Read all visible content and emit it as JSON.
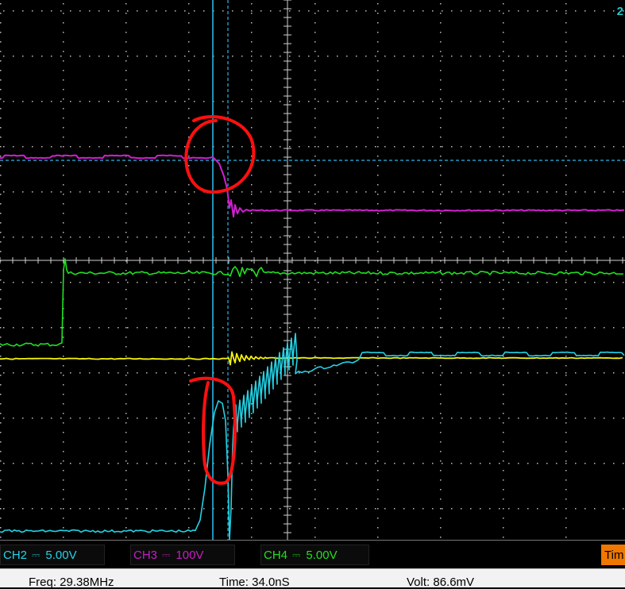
{
  "screen": {
    "corner_label": "2"
  },
  "channels": [
    {
      "name": "CH2",
      "coupling": "⎓",
      "scale": "5.00V",
      "color": "#22d3e6"
    },
    {
      "name": "CH3",
      "coupling": "⎓",
      "scale": "100V",
      "color": "#c020c0"
    },
    {
      "name": "CH4",
      "coupling": "⎓",
      "scale": "5.00V",
      "color": "#20e020"
    }
  ],
  "timebase_label": "Tim",
  "measurements": {
    "freq": "Freq: 29.38MHz",
    "time": "Time: 34.0nS",
    "volt": "Volt: 86.6mV"
  },
  "colors": {
    "ch2": "#22d3e6",
    "ch3": "#d020d0",
    "ch4": "#20e020",
    "ch1": "#f2f20a",
    "cursor": "#2ab6e6",
    "annotation": "#ff1010",
    "timebase": "#ff8a00"
  }
}
